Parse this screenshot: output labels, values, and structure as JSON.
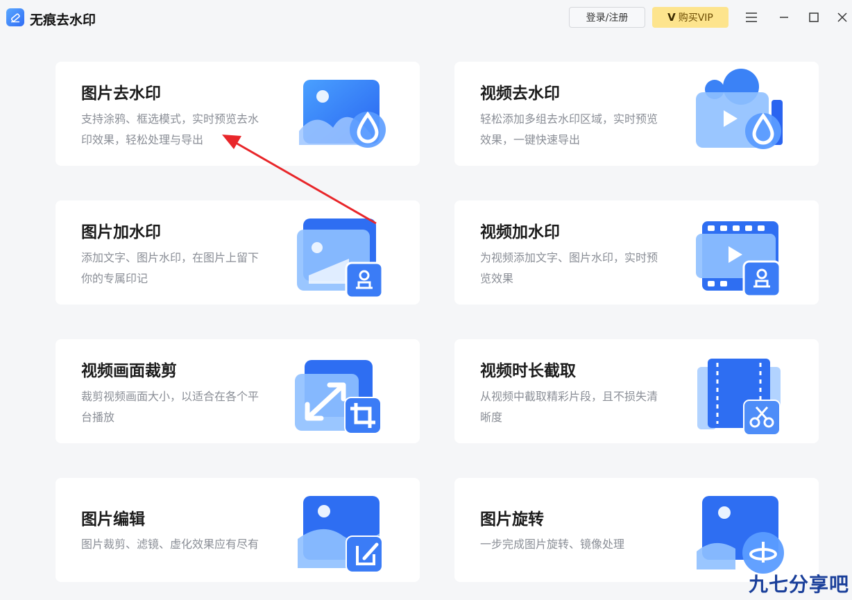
{
  "app": {
    "title": "无痕去水印",
    "logo_icon": "eraser-icon"
  },
  "header": {
    "login_label": "登录/注册",
    "vip_label": "购买VIP",
    "vip_mark": "V"
  },
  "window_controls": [
    "menu-icon",
    "minimize-icon",
    "maximize-icon",
    "close-icon"
  ],
  "cards": [
    {
      "title": "图片去水印",
      "desc_line1": "支持涂鸦、框选模式，实时预览去水",
      "desc_line2": "印效果，轻松处理与导出",
      "icon": "image-drop-icon"
    },
    {
      "title": "视频去水印",
      "desc_line1": "轻松添加多组去水印区域，实时预览",
      "desc_line2": "效果，一键快速导出",
      "icon": "video-drop-icon"
    },
    {
      "title": "图片加水印",
      "desc_line1": "添加文字、图片水印，在图片上留下",
      "desc_line2": "你的专属印记",
      "icon": "image-stamp-icon"
    },
    {
      "title": "视频加水印",
      "desc_line1": "为视频添加文字、图片水印，实时预",
      "desc_line2": "览效果",
      "icon": "video-stamp-icon"
    },
    {
      "title": "视频画面裁剪",
      "desc_line1": "裁剪视频画面大小，以适合在各个平",
      "desc_line2": "台播放",
      "icon": "crop-resize-icon"
    },
    {
      "title": "视频时长截取",
      "desc_line1": "从视频中截取精彩片段，且不损失清",
      "desc_line2": "晰度",
      "icon": "film-scissors-icon"
    },
    {
      "title": "图片编辑",
      "desc_line1": "图片裁剪、滤镜、虚化效果应有尽有",
      "desc_line2": "",
      "icon": "image-edit-icon"
    },
    {
      "title": "图片旋转",
      "desc_line1": "一步完成图片旋转、镜像处理",
      "desc_line2": "",
      "icon": "image-rotate-icon"
    }
  ],
  "watermark": "九七分享吧",
  "colors": {
    "accent_blue": "#2f6cf5",
    "light_blue": "#5aa8ff",
    "vip_yellow": "#fde48d",
    "arrow_red": "#e8262a",
    "background": "#f5f6f8"
  }
}
